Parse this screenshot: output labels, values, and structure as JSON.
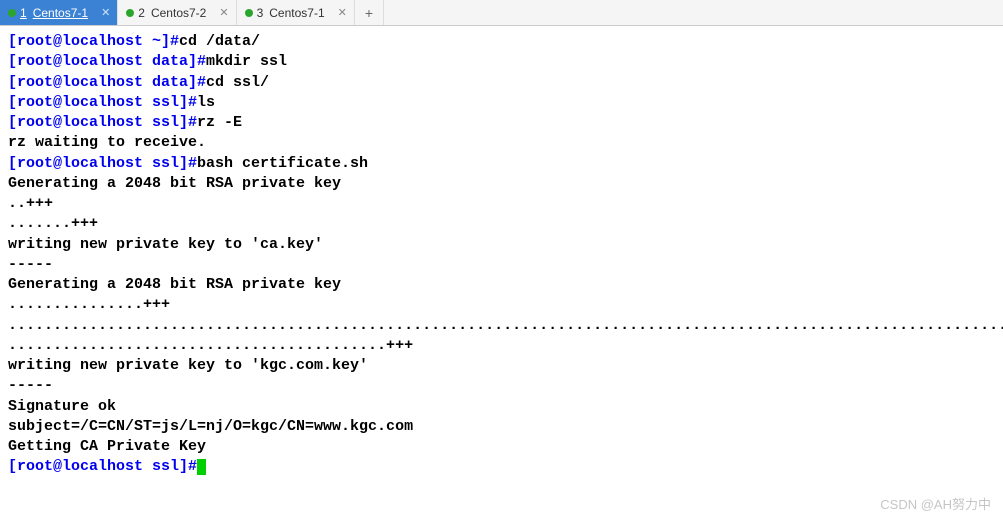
{
  "tabs": [
    {
      "num": "1",
      "label": "Centos7-1",
      "active": true
    },
    {
      "num": "2",
      "label": "Centos7-2",
      "active": false
    },
    {
      "num": "3",
      "label": "Centos7-1",
      "active": false
    }
  ],
  "addtab": "+",
  "lines": [
    {
      "prompt": "[root@localhost ~]#",
      "cmd": "cd /data/"
    },
    {
      "prompt": "[root@localhost data]#",
      "cmd": "mkdir ssl"
    },
    {
      "prompt": "[root@localhost data]#",
      "cmd": "cd ssl/"
    },
    {
      "prompt": "[root@localhost ssl]#",
      "cmd": "ls"
    },
    {
      "prompt": "[root@localhost ssl]#",
      "cmd": "rz -E"
    },
    {
      "out": "rz waiting to receive."
    },
    {
      "prompt": "[root@localhost ssl]#",
      "cmd": "bash certificate.sh"
    },
    {
      "out": "Generating a 2048 bit RSA private key"
    },
    {
      "out": "..+++"
    },
    {
      "out": ".......+++"
    },
    {
      "out": "writing new private key to 'ca.key'"
    },
    {
      "out": "-----"
    },
    {
      "out": "Generating a 2048 bit RSA private key"
    },
    {
      "out": "...............+++"
    },
    {
      "out": "................................................................................................................"
    },
    {
      "out": "..........................................+++"
    },
    {
      "out": "writing new private key to 'kgc.com.key'"
    },
    {
      "out": "-----"
    },
    {
      "out": "Signature ok"
    },
    {
      "out": "subject=/C=CN/ST=js/L=nj/O=kgc/CN=www.kgc.com"
    },
    {
      "out": "Getting CA Private Key"
    },
    {
      "prompt": "[root@localhost ssl]#",
      "cmd": "",
      "cursor": true
    }
  ],
  "watermark": "CSDN @AH努力中"
}
